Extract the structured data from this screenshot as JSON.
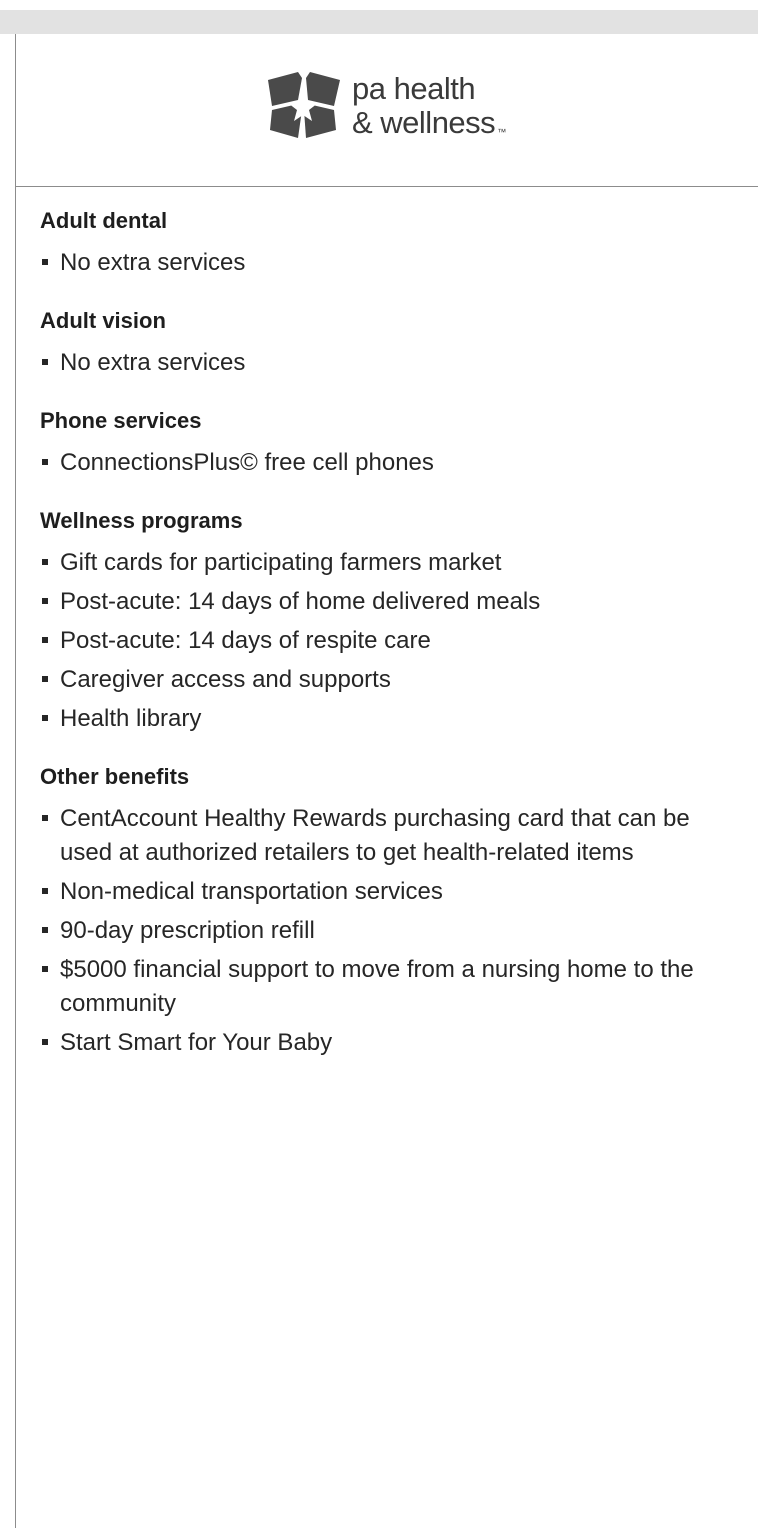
{
  "header": {
    "logo": {
      "line1": "pa health",
      "line2": "& wellness",
      "trademark": "™"
    }
  },
  "sections": [
    {
      "title": "Adult dental",
      "items": [
        "No extra services"
      ]
    },
    {
      "title": "Adult vision",
      "items": [
        "No extra services"
      ]
    },
    {
      "title": "Phone services",
      "items": [
        "ConnectionsPlus© free cell phones"
      ]
    },
    {
      "title": "Wellness programs",
      "items": [
        "Gift cards for participating farmers market",
        "Post-acute: 14 days of home delivered meals",
        "Post-acute: 14 days of respite care",
        "Caregiver access and supports",
        "Health library"
      ]
    },
    {
      "title": "Other benefits",
      "items": [
        "CentAccount Healthy Rewards purchasing card that can be used at authorized retailers to get health-related items",
        "Non-medical transportation services",
        "90-day prescription refill",
        "$5000 financial support to move from a nursing home to the community",
        "Start Smart for Your Baby"
      ]
    }
  ],
  "colors": {
    "top_bar": "#e2e2e2",
    "rule": "#8c8c8c",
    "logo": "#4a4a4a",
    "text": "#262626"
  },
  "icons": {
    "logo_mark": "pa-health-star-logo-icon",
    "bullet": "square-bullet-icon"
  }
}
